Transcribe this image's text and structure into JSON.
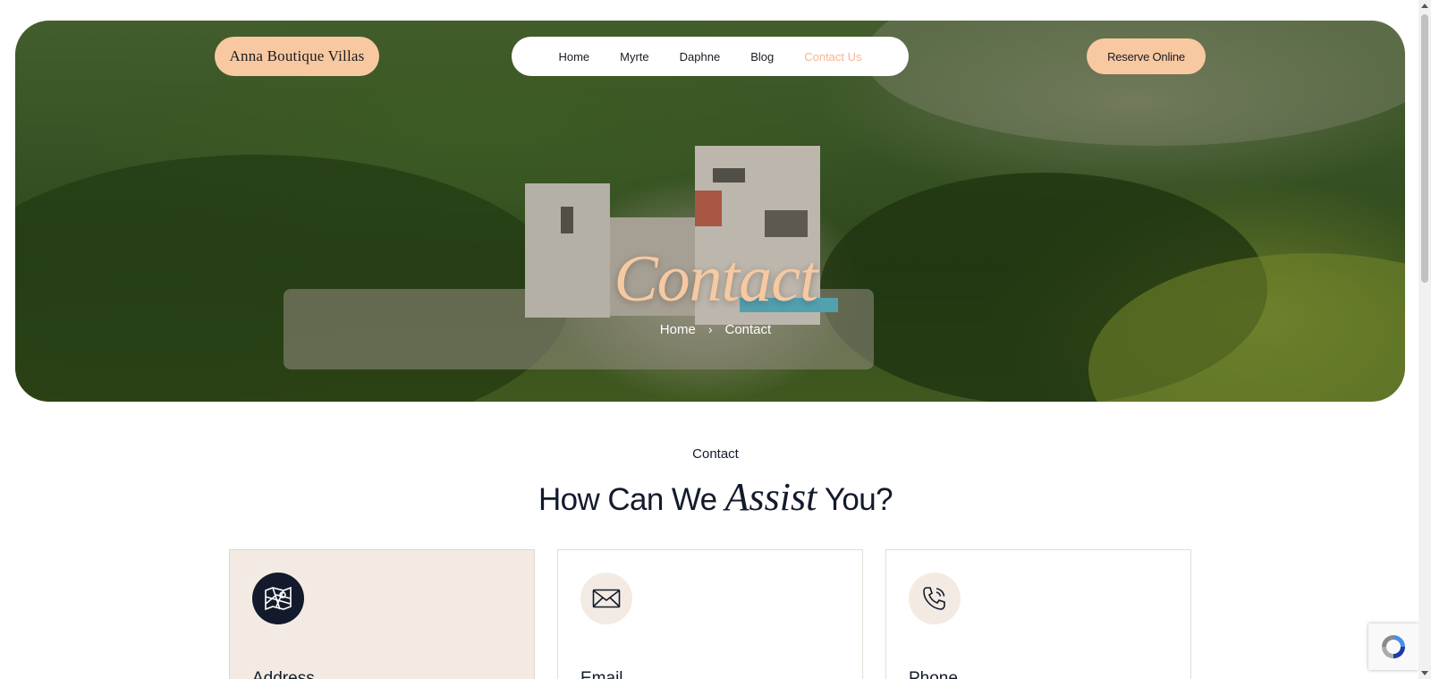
{
  "header": {
    "brand": "Anna Boutique Villas",
    "nav": [
      {
        "label": "Home",
        "active": false
      },
      {
        "label": "Myrte",
        "active": false
      },
      {
        "label": "Daphne",
        "active": false
      },
      {
        "label": "Blog",
        "active": false
      },
      {
        "label": "Contact Us",
        "active": true
      }
    ],
    "reserve_label": "Reserve Online"
  },
  "hero": {
    "title": "Contact",
    "breadcrumb": {
      "home": "Home",
      "separator": "›",
      "current": "Contact"
    }
  },
  "section": {
    "eyebrow": "Contact",
    "heading_before": "How Can We ",
    "heading_script": "Assist",
    "heading_after": " You?"
  },
  "cards": [
    {
      "title": "Address",
      "icon": "map-icon"
    },
    {
      "title": "Email",
      "icon": "envelope-icon"
    },
    {
      "title": "Phone",
      "icon": "phone-icon"
    }
  ],
  "colors": {
    "accent": "#f8c9a0",
    "active_link": "#f4b690",
    "navy": "#121a2c",
    "card_tint": "#f3ebe3"
  }
}
